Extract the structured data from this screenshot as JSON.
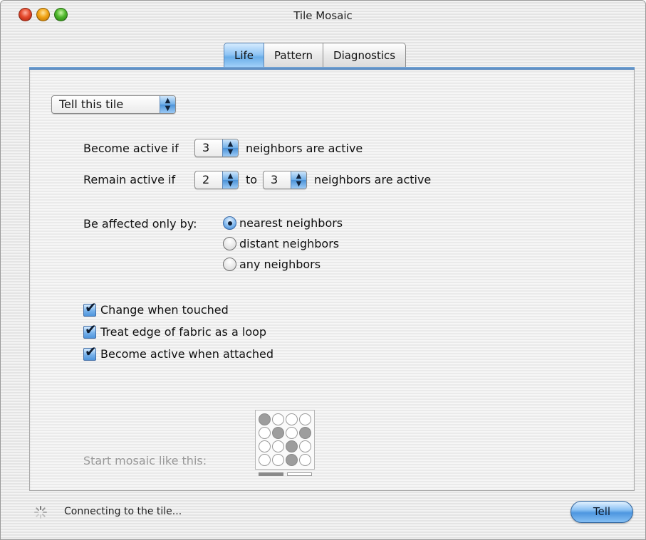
{
  "window": {
    "title": "Tile Mosaic"
  },
  "tabs": [
    {
      "label": "Life",
      "active": true
    },
    {
      "label": "Pattern",
      "active": false
    },
    {
      "label": "Diagnostics",
      "active": false
    }
  ],
  "target_popup": {
    "selected": "Tell this tile"
  },
  "rules": {
    "become_prefix": "Become active if",
    "become_value": "3",
    "become_suffix": "neighbors are active",
    "remain_prefix": "Remain active if",
    "remain_min": "2",
    "remain_to": "to",
    "remain_max": "3",
    "remain_suffix": "neighbors are active"
  },
  "affected": {
    "label": "Be affected only by:",
    "options": [
      {
        "label": "nearest neighbors",
        "selected": true
      },
      {
        "label": "distant neighbors",
        "selected": false
      },
      {
        "label": "any neighbors",
        "selected": false
      }
    ]
  },
  "checks": [
    {
      "label": "Change when touched",
      "checked": true
    },
    {
      "label": "Treat edge of fabric as a loop",
      "checked": true
    },
    {
      "label": "Become active when attached",
      "checked": true
    }
  ],
  "mosaic": {
    "label": "Start mosaic like this:",
    "grid": [
      [
        1,
        0,
        0,
        0
      ],
      [
        0,
        1,
        0,
        1
      ],
      [
        0,
        0,
        1,
        0
      ],
      [
        0,
        0,
        1,
        0
      ]
    ]
  },
  "status": {
    "text": "Connecting to the tile..."
  },
  "tell_button": {
    "label": "Tell"
  },
  "colors": {
    "accent": "#6aaee8",
    "active_cell": "#9d9d9d"
  },
  "icons": {
    "spinner": "progress-spinner-icon",
    "checkmark": "checkmark-icon",
    "popup_arrows": "updown-arrows-icon"
  }
}
